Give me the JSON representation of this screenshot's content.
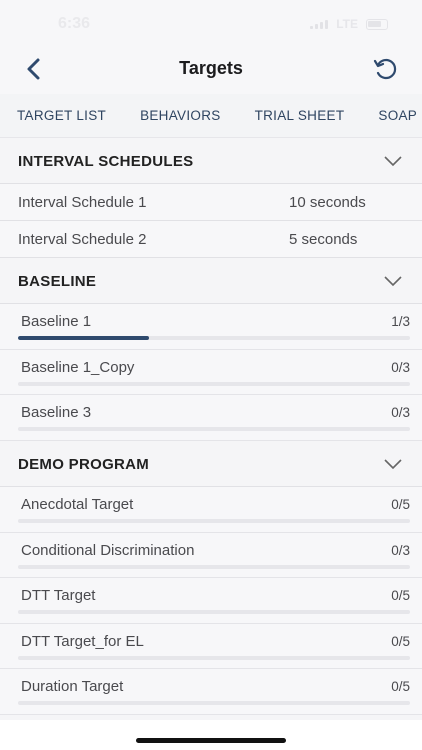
{
  "status_bar": {
    "time": "6:36",
    "network": "LTE"
  },
  "header": {
    "title": "Targets"
  },
  "tabs": [
    {
      "label": "TARGET LIST"
    },
    {
      "label": "BEHAVIORS"
    },
    {
      "label": "TRIAL SHEET"
    },
    {
      "label": "SOAP"
    }
  ],
  "sections": {
    "interval_schedules": {
      "title": "INTERVAL SCHEDULES",
      "items": [
        {
          "name": "Interval Schedule 1",
          "value": "10 seconds"
        },
        {
          "name": "Interval Schedule 2",
          "value": "5 seconds"
        }
      ]
    },
    "baseline": {
      "title": "BASELINE",
      "items": [
        {
          "name": "Baseline 1",
          "count": "1/3",
          "progress": 0.333
        },
        {
          "name": "Baseline 1_Copy",
          "count": "0/3",
          "progress": 0
        },
        {
          "name": "Baseline 3",
          "count": "0/3",
          "progress": 0
        }
      ]
    },
    "demo_program": {
      "title": "DEMO PROGRAM",
      "items": [
        {
          "name": "Anecdotal Target",
          "count": "0/5",
          "progress": 0
        },
        {
          "name": "Conditional Discrimination",
          "count": "0/3",
          "progress": 0
        },
        {
          "name": "DTT Target",
          "count": "0/5",
          "progress": 0
        },
        {
          "name": "DTT Target_for EL",
          "count": "0/5",
          "progress": 0
        },
        {
          "name": "Duration Target",
          "count": "0/5",
          "progress": 0
        }
      ]
    }
  },
  "colors": {
    "accent": "#2f4a6e",
    "tab_text": "#2f4561",
    "track": "#e6e6ea"
  }
}
